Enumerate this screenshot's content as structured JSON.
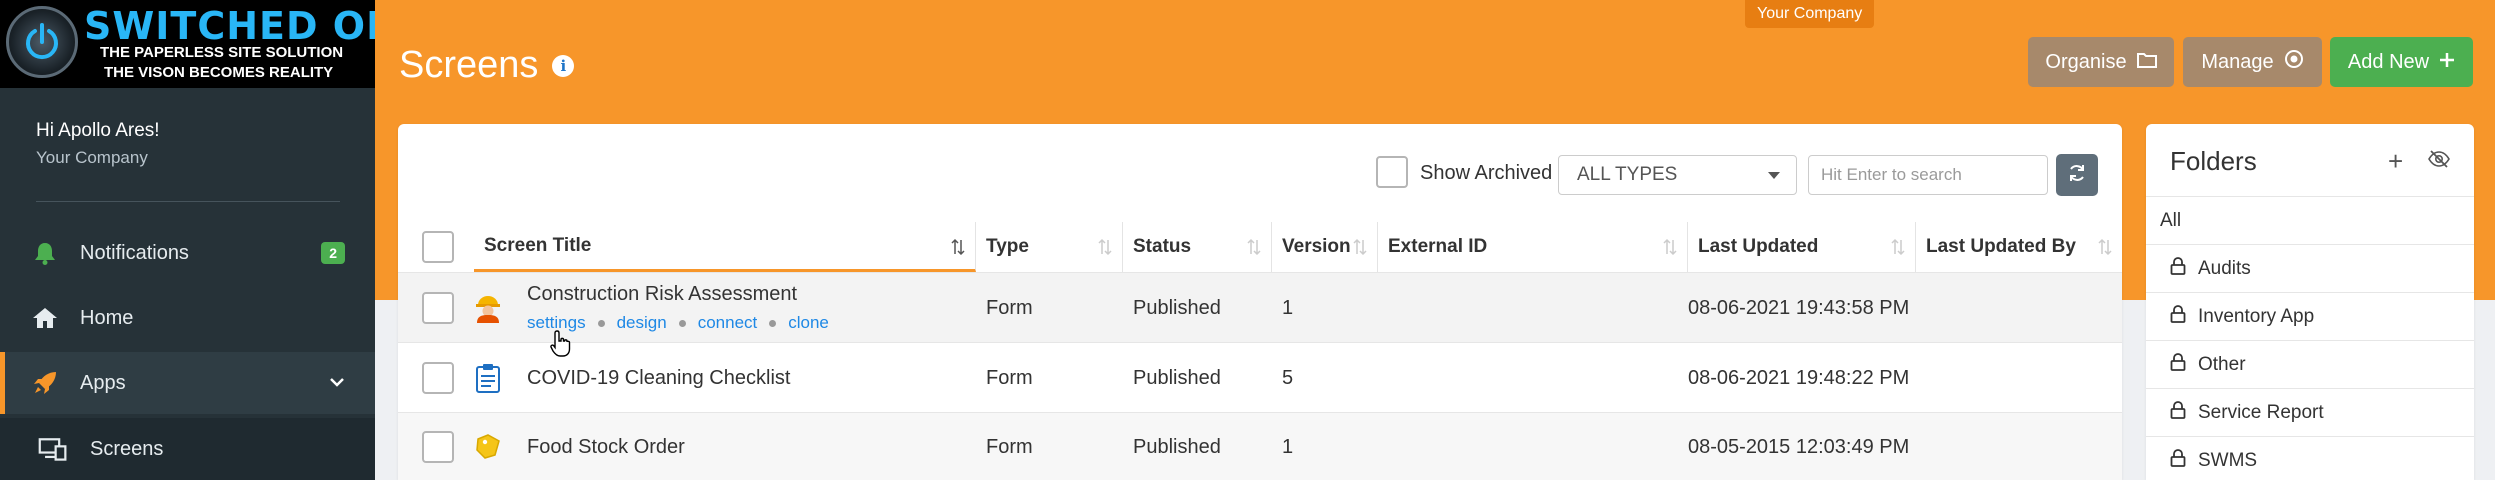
{
  "brand": {
    "title": "SWITCHED ON",
    "subtitle_1": "THE PAPERLESS SITE SOLUTION",
    "subtitle_2": "THE VISON BECOMES REALITY"
  },
  "user": {
    "greeting": "Hi Apollo Ares!",
    "company": "Your Company"
  },
  "nav": {
    "notifications": {
      "label": "Notifications",
      "badge": "2"
    },
    "home": {
      "label": "Home"
    },
    "apps": {
      "label": "Apps"
    },
    "screens": {
      "label": "Screens"
    }
  },
  "header": {
    "company_tab": "Your Company",
    "title": "Screens",
    "info": "i",
    "organise": "Organise",
    "manage": "Manage",
    "add_new": "Add New"
  },
  "toolbar": {
    "show_archived": "Show Archived",
    "type_filter": "ALL TYPES",
    "search_placeholder": "Hit Enter to search"
  },
  "table": {
    "columns": [
      "Screen Title",
      "Type",
      "Status",
      "Version",
      "External ID",
      "Last Updated",
      "Last Updated By"
    ],
    "row_actions": [
      "settings",
      "design",
      "connect",
      "clone"
    ],
    "rows": [
      {
        "title": "Construction Risk Assessment",
        "type": "Form",
        "status": "Published",
        "version": "1",
        "external_id": "",
        "last_updated": "08-06-2021 19:43:58 PM",
        "last_updated_by": ""
      },
      {
        "title": "COVID-19 Cleaning Checklist",
        "type": "Form",
        "status": "Published",
        "version": "5",
        "external_id": "",
        "last_updated": "08-06-2021 19:48:22 PM",
        "last_updated_by": ""
      },
      {
        "title": "Food Stock Order",
        "type": "Form",
        "status": "Published",
        "version": "1",
        "external_id": "",
        "last_updated": "08-05-2015 12:03:49 PM",
        "last_updated_by": ""
      }
    ]
  },
  "folders": {
    "title": "Folders",
    "add": "+",
    "all": "All",
    "items": [
      "Audits",
      "Inventory App",
      "Other",
      "Service Report",
      "SWMS"
    ]
  },
  "colors": {
    "accent": "#f7962a",
    "sidebar": "#263238",
    "success": "#4caf50",
    "link": "#1e88e5",
    "muted_button": "#a7896b"
  }
}
